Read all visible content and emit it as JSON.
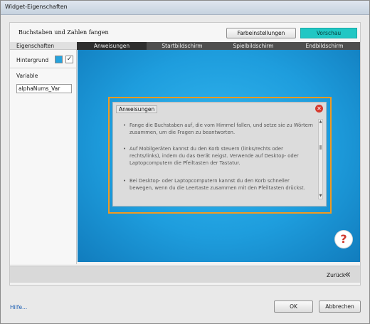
{
  "window": {
    "title": "Widget-Eigenschaften"
  },
  "header": {
    "title": "Buchstaben und Zahlen fangen",
    "color_settings_label": "Farbeinstellungen",
    "preview_label": "Vorschau"
  },
  "sidebar": {
    "heading": "Eigenschaften",
    "background_label": "Hintergrund",
    "background_color": "#26a3dd",
    "background_checked": true,
    "variable_label": "Variable",
    "variable_value": "alphaNums_Var"
  },
  "tabs": [
    {
      "label": "Anweisungen",
      "active": true
    },
    {
      "label": "Startbildschirm",
      "active": false
    },
    {
      "label": "Spielbildschirm",
      "active": false
    },
    {
      "label": "Endbildschirm",
      "active": false
    }
  ],
  "dialog": {
    "title": "Anweisungen",
    "close_icon": "close-icon",
    "bullet": "•",
    "items": [
      "Fange die Buchstaben auf, die vom Himmel fallen, und setze sie zu Wörtern zusammen, um die Fragen zu beantworten.",
      "Auf Mobilgeräten kannst du den Korb steuern (links/rechts oder rechts/links), indem du das Gerät neigst. Verwende auf Desktop- oder Laptopcomputern die Pfeiltasten der Tastatur.",
      "Bei Desktop- oder Laptopcomputern kannst du den Korb schneller bewegen, wenn du die Leertaste zusammen mit den Pfeiltasten drückst."
    ]
  },
  "help_icon": "?",
  "navigation": {
    "back_label": "Zurück",
    "back_icon": "«"
  },
  "footer": {
    "help_link": "Hilfe...",
    "ok_label": "OK",
    "cancel_label": "Abbrechen"
  },
  "colors": {
    "accent_preview": "#21c7c4",
    "canvas_blue": "#1e9ddd",
    "dialog_frame": "#f29a1f",
    "close_red": "#d63a2e"
  }
}
